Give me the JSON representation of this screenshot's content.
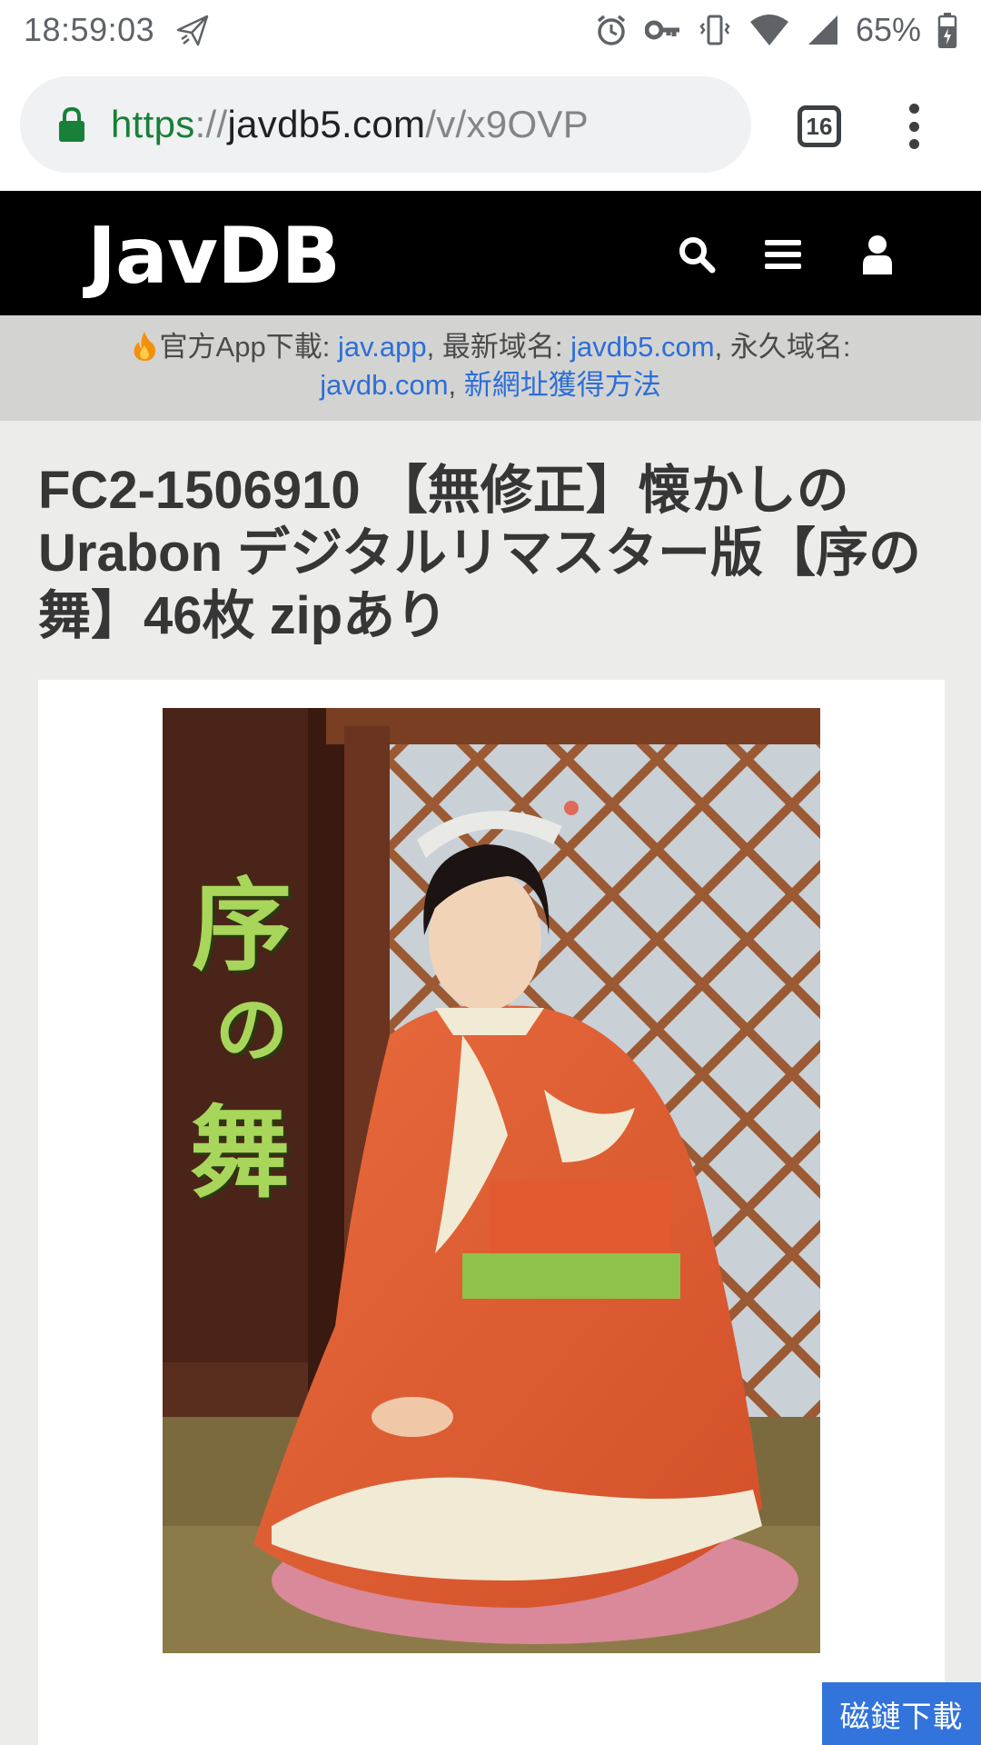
{
  "status_bar": {
    "time": "18:59:03",
    "battery": "65%",
    "icons": [
      "send-icon",
      "alarm-icon",
      "key-icon",
      "vibrate-icon",
      "wifi-icon",
      "signal-icon",
      "battery-icon"
    ]
  },
  "browser": {
    "url_scheme": "https",
    "url_sep": "://",
    "url_host": "javdb5.com",
    "url_path": "/v/x9OVP",
    "tab_count": "16"
  },
  "site": {
    "logo": "JavDB",
    "nav_icons": [
      "search-icon",
      "menu-icon",
      "user-icon"
    ]
  },
  "notice": {
    "prefix": "官方App下載: ",
    "app_link": "jav.app",
    "latest_label": ", 最新域名: ",
    "latest_link": "javdb5.com",
    "permanent_label": ", 永久域名: ",
    "permanent_link": "javdb.com",
    "comma": ", ",
    "howto_link": "新網址獲得方法"
  },
  "title": "FC2-1506910 【無修正】懐かしのUrabon デジタルリマスター版【序の舞】46枚 zipあり",
  "cover": {
    "title_text": [
      "序",
      "の",
      "舞"
    ]
  },
  "magnet_button": "磁鏈下載",
  "colors": {
    "navbar": "#000000",
    "link": "#2d6ed8",
    "button": "#3273dc",
    "secure": "#188038"
  }
}
